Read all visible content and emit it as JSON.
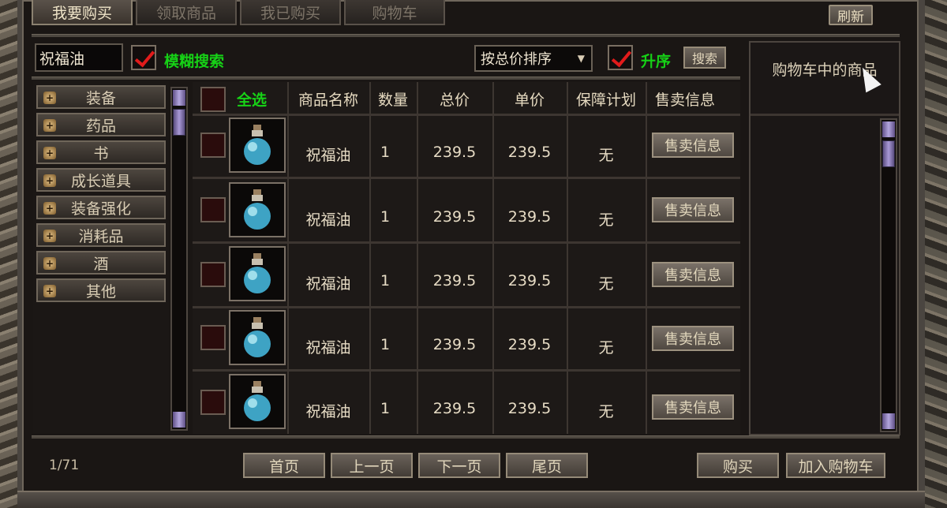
{
  "tabs": [
    {
      "label": "我要购买",
      "active": true
    },
    {
      "label": "领取商品",
      "active": false
    },
    {
      "label": "我已购买",
      "active": false
    },
    {
      "label": "购物车",
      "active": false
    }
  ],
  "refresh_label": "刷新",
  "search": {
    "value": "祝福油",
    "fuzzy_checked": true,
    "fuzzy_label": "模糊搜索",
    "sort_selected": "按总价排序",
    "asc_checked": true,
    "asc_label": "升序",
    "search_button": "搜索"
  },
  "categories": [
    "装备",
    "药品",
    "书",
    "成长道具",
    "装备强化",
    "消耗品",
    "酒",
    "其他"
  ],
  "table": {
    "select_all": "全选",
    "headers": [
      "商品名称",
      "数量",
      "总价",
      "单价",
      "保障计划",
      "售卖信息"
    ],
    "rows": [
      {
        "name": "祝福油",
        "qty": "1",
        "total": "239.5",
        "unit": "239.5",
        "guarantee": "无",
        "action": "售卖信息"
      },
      {
        "name": "祝福油",
        "qty": "1",
        "total": "239.5",
        "unit": "239.5",
        "guarantee": "无",
        "action": "售卖信息"
      },
      {
        "name": "祝福油",
        "qty": "1",
        "total": "239.5",
        "unit": "239.5",
        "guarantee": "无",
        "action": "售卖信息"
      },
      {
        "name": "祝福油",
        "qty": "1",
        "total": "239.5",
        "unit": "239.5",
        "guarantee": "无",
        "action": "售卖信息"
      },
      {
        "name": "祝福油",
        "qty": "1",
        "total": "239.5",
        "unit": "239.5",
        "guarantee": "无",
        "action": "售卖信息"
      }
    ]
  },
  "cart": {
    "title": "购物车中的商品"
  },
  "footer": {
    "page_info": "1/71",
    "first": "首页",
    "prev": "上一页",
    "next": "下一页",
    "last": "尾页",
    "buy": "购买",
    "add_to_cart": "加入购物车"
  },
  "colors": {
    "accent_green": "#16d116",
    "check_red": "#e21b1b"
  },
  "icons": [
    "potion-bottle-icon",
    "plus-icon",
    "checkmark-icon",
    "cursor-arrow-icon"
  ]
}
